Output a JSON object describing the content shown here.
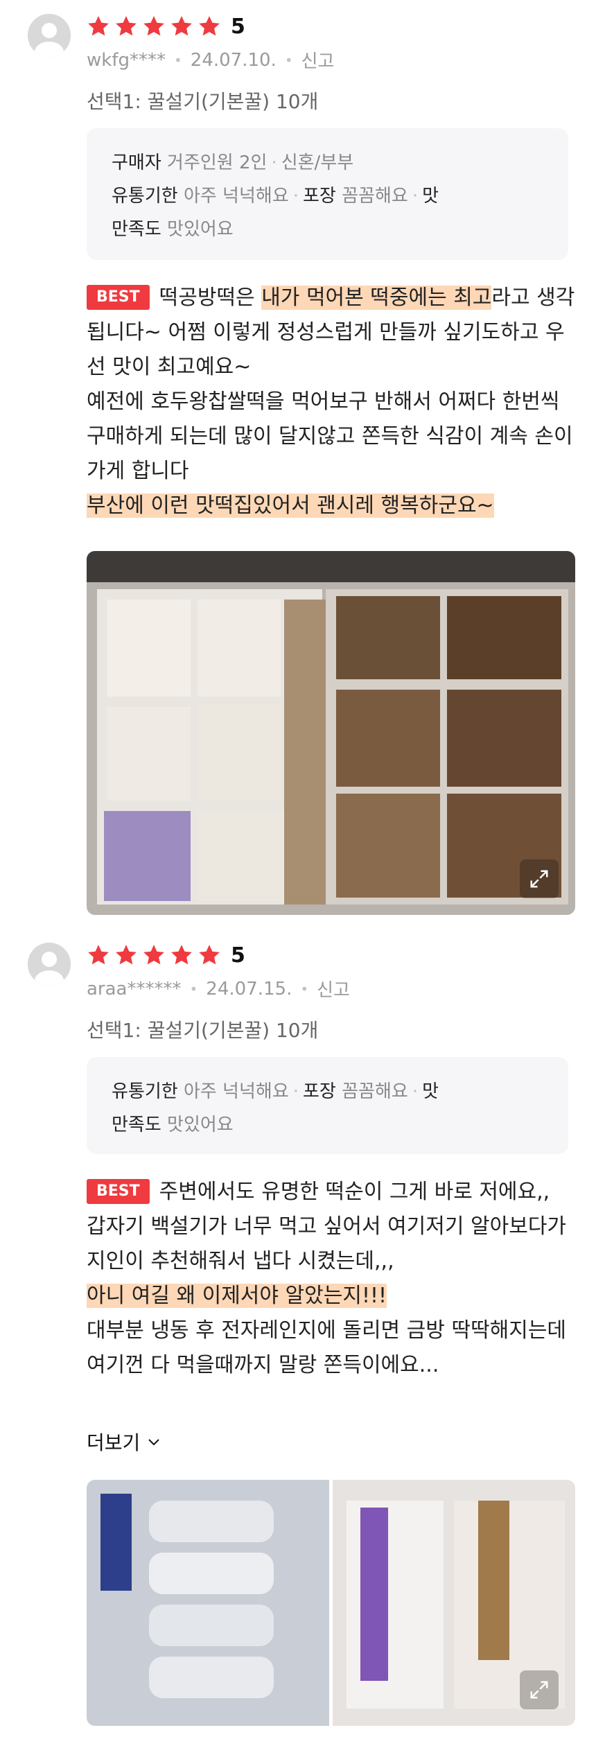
{
  "reviews": [
    {
      "rating": "5",
      "user": "wkfg****",
      "date": "24.07.10.",
      "report": "신고",
      "option": "선택1: 꿀설기(기본꿀) 10개",
      "survey": {
        "buyer_key": "구매자",
        "buyer_val": "거주인원 2인",
        "buyer_val2": "신혼/부부",
        "expiry_key": "유통기한",
        "expiry_val": "아주 넉넉해요",
        "pack_key": "포장",
        "pack_val": "꼼꼼해요",
        "taste_key1": "맛",
        "taste_key2": "만족도",
        "taste_val": "맛있어요"
      },
      "best": "BEST",
      "text": {
        "p1": "떡공방떡은 ",
        "p1_hl": "내가 먹어본 떡중에는 최고",
        "p2": "라고 생각됩니다~  어쩜 이렇게  정성스럽게 만들까 싶기도하고  우선 맛이 최고예요~",
        "p3": "예전에 호두왕찹쌀떡을 먹어보구 반해서  어쩌다 한번씩 구매하게 되는데 많이 달지않고 쫀득한 식감이 계속 손이가게 합니다",
        "p4_hl": "부산에 이런  맛떡집있어서  괜시레 행복하군요~"
      }
    },
    {
      "rating": "5",
      "user": "araa******",
      "date": "24.07.15.",
      "report": "신고",
      "option": "선택1: 꿀설기(기본꿀) 10개",
      "survey": {
        "expiry_key": "유통기한",
        "expiry_val": "아주 넉넉해요",
        "pack_key": "포장",
        "pack_val": "꼼꼼해요",
        "taste_key1": "맛",
        "taste_key2": "만족도",
        "taste_val": "맛있어요"
      },
      "best": "BEST",
      "text": {
        "p1": "주변에서도 유명한 떡순이 그게 바로 저에요,,",
        "p2": "갑자기 백설기가 너무 먹고 싶어서 여기저기 알아보다가 지인이 추천해줘서 냅다 시켰는데,,,",
        "p3_hl": "아니 여길 왜 이제서야 알았는지!!!",
        "p4": "대부분 냉동 후 전자레인지에 돌리면 금방 딱딱해지는데 여기껀 다 먹을때까지 말랑 쫀득이에요..."
      },
      "more": "더보기"
    }
  ],
  "colors": {
    "star": "#ef3a3f",
    "best_bg": "#ef3a3f",
    "highlight": "#fdd7b6",
    "survey_bg": "#f6f6f8"
  },
  "icons": [
    "user-avatar-icon",
    "star-icon",
    "chevron-down-icon",
    "expand-icon"
  ]
}
